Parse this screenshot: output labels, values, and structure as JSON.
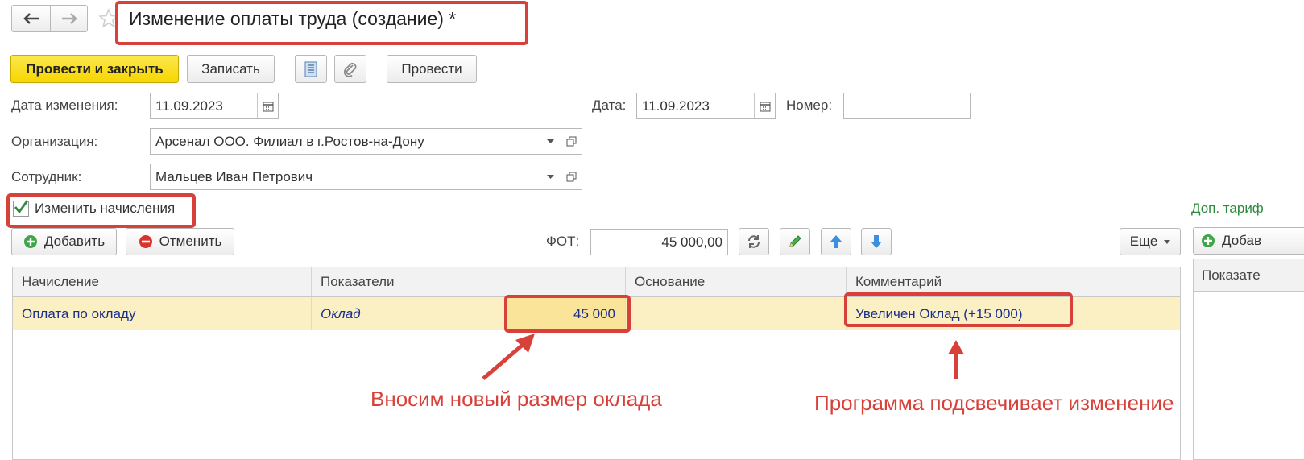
{
  "window": {
    "title": "Изменение оплаты труда (создание) *"
  },
  "toolbar": {
    "post_close_label": "Провести и закрыть",
    "save_label": "Записать",
    "post_label": "Провести"
  },
  "form": {
    "change_date_label": "Дата изменения:",
    "change_date_value": "11.09.2023",
    "date_label": "Дата:",
    "date_value": "11.09.2023",
    "number_label": "Номер:",
    "number_value": "",
    "organization_label": "Организация:",
    "organization_value": "Арсенал ООО. Филиал в г.Ростов-на-Дону",
    "employee_label": "Сотрудник:",
    "employee_value": "Мальцев Иван Петрович",
    "change_accruals_label": "Изменить начисления",
    "change_accruals_checked": true
  },
  "grid_toolbar": {
    "add_label": "Добавить",
    "cancel_label": "Отменить",
    "fot_label": "ФОТ:",
    "fot_value": "45 000,00",
    "more_label": "Еще"
  },
  "grid": {
    "columns": [
      "Начисление",
      "Показатели",
      "Основание",
      "Комментарий"
    ],
    "rows": [
      {
        "accrual": "Оплата по окладу",
        "indicator": "Оклад",
        "indicator_value": "45 000",
        "basis": "",
        "comment": "Увеличен Оклад (+15 000)"
      }
    ]
  },
  "side_panel": {
    "title": "Доп. тариф",
    "add_label": "Добав",
    "column": "Показате"
  },
  "annotations": {
    "left": "Вносим новый размер оклада",
    "right": "Программа подсвечивает изменение"
  },
  "colors": {
    "accent_red": "#d8403a",
    "primary_yellow": "#f6d500",
    "row_highlight": "#fbf0c4",
    "cell_highlight": "#f9e49a",
    "link_green": "#2e8b3c",
    "link_blue": "#1c2f8c"
  },
  "icons": [
    "back-arrow-icon",
    "forward-arrow-icon",
    "star-icon",
    "document-list-icon",
    "paperclip-icon",
    "calendar-icon",
    "dropdown-arrow-icon",
    "open-form-icon",
    "checkmark-icon",
    "plus-circle-icon",
    "minus-circle-icon",
    "refresh-icon",
    "pencil-icon",
    "arrow-up-icon",
    "arrow-down-icon"
  ]
}
